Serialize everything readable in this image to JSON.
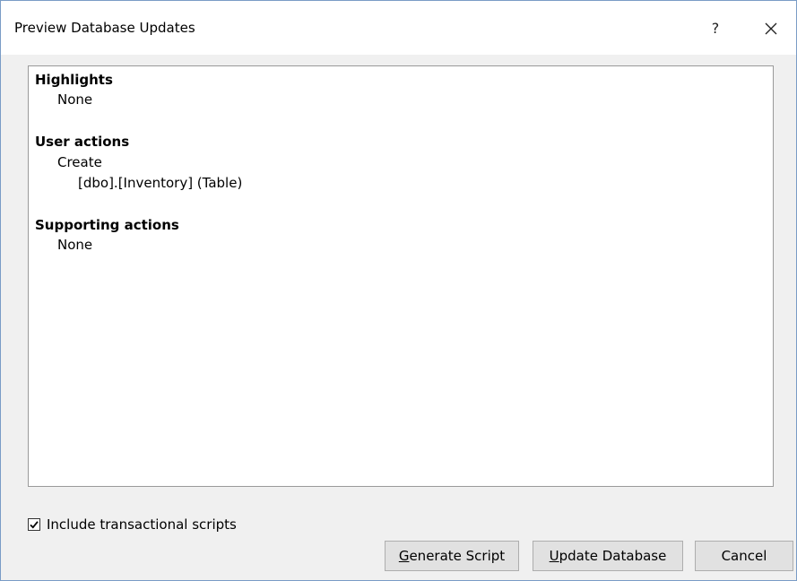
{
  "window": {
    "title": "Preview Database Updates",
    "help_label": "?",
    "close_icon": "close-icon"
  },
  "content": {
    "highlights": {
      "heading": "Highlights",
      "items": [
        "None"
      ]
    },
    "user_actions": {
      "heading": "User actions",
      "action": "Create",
      "targets": [
        "[dbo].[Inventory] (Table)"
      ]
    },
    "supporting_actions": {
      "heading": "Supporting actions",
      "items": [
        "None"
      ]
    }
  },
  "options": {
    "include_transactional_scripts": {
      "label": "Include transactional scripts",
      "checked": true
    }
  },
  "buttons": {
    "generate_script": {
      "mnemonic": "G",
      "rest": "enerate Script"
    },
    "update_database": {
      "mnemonic": "U",
      "rest": "pdate Database"
    },
    "cancel": "Cancel"
  },
  "colors": {
    "dialog_border": "#7a9cc6",
    "dialog_background": "#f0f0f0",
    "button_background": "#e1e1e1",
    "button_border": "#adadad"
  }
}
